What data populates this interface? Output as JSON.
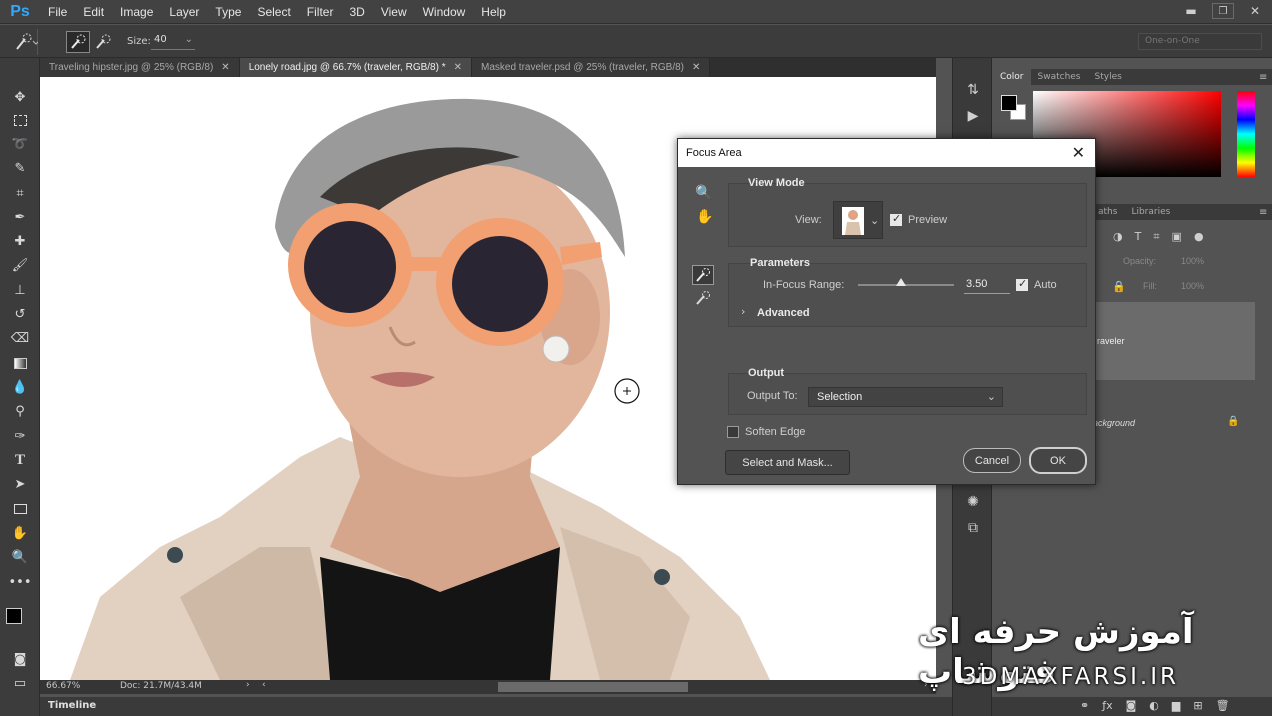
{
  "app": {
    "logo": "Ps",
    "accent": "#31a8ff"
  },
  "menu": [
    "File",
    "Edit",
    "Image",
    "Layer",
    "Type",
    "Select",
    "Filter",
    "3D",
    "View",
    "Window",
    "Help"
  ],
  "options": {
    "size_label": "Size:",
    "size_value": "40",
    "workspace": "One-on-One"
  },
  "tabs": [
    {
      "label": "Traveling hipster.jpg @ 25% (RGB/8)",
      "active": false
    },
    {
      "label": "Lonely road.jpg @ 66.7% (traveler, RGB/8) *",
      "active": true
    },
    {
      "label": "Masked traveler.psd @ 25% (traveler, RGB/8)",
      "active": false
    }
  ],
  "status": {
    "zoom": "66.67%",
    "doc": "Doc: 21.7M/43.4M"
  },
  "timeline": "Timeline",
  "panels": {
    "color_tabs": [
      "Color",
      "Swatches",
      "Styles"
    ],
    "layer_tabs": [
      "aths",
      "Libraries"
    ],
    "opacity_label": "Opacity:",
    "opacity_value": "100%",
    "fill_label": "Fill:",
    "fill_value": "100%",
    "layer_name": "raveler",
    "background_name": "ackground"
  },
  "dialog": {
    "title": "Focus Area",
    "view_mode": "View Mode",
    "view_label": "View:",
    "preview_label": "Preview",
    "preview_checked": true,
    "parameters": "Parameters",
    "range_label": "In-Focus Range:",
    "range_value": "3.50",
    "range_fraction": 0.45,
    "auto_label": "Auto",
    "auto_checked": true,
    "advanced": "Advanced",
    "output": "Output",
    "output_to_label": "Output To:",
    "output_to_value": "Selection",
    "soften_edge": "Soften Edge",
    "soften_checked": false,
    "select_mask": "Select and Mask...",
    "cancel": "Cancel",
    "ok": "OK"
  },
  "watermark": {
    "persian": "آموزش حرفه ای فتوشاپ",
    "site": "3DMAXFARSI.IR"
  }
}
